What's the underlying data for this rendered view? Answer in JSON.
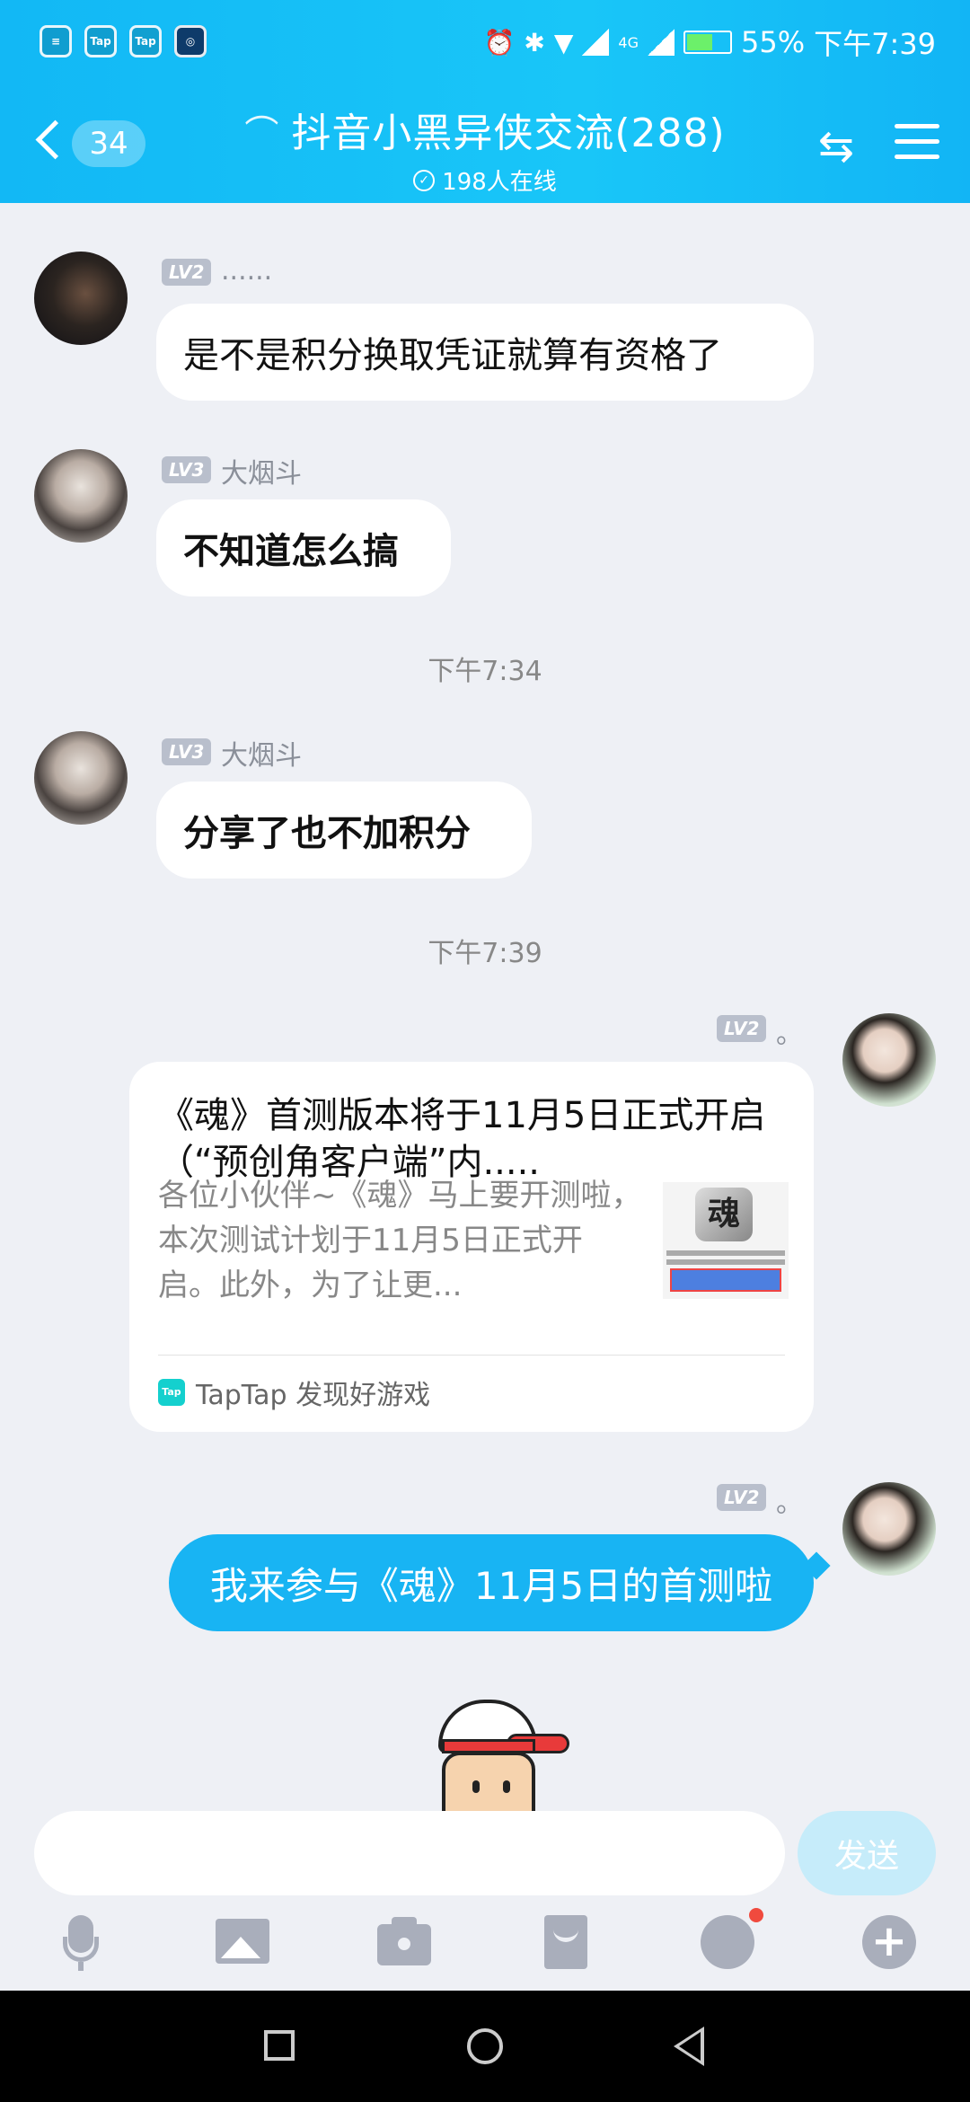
{
  "status_bar": {
    "apps": [
      "Tap",
      "Tap"
    ],
    "network": "4G",
    "battery": "55%",
    "time": "下午7:39",
    "battery_level": 0.55
  },
  "header": {
    "unread_count": "34",
    "title": "抖音小黑异侠交流(288)",
    "online": "198人在线"
  },
  "messages": [
    {
      "level": "LV2",
      "nickname": "......",
      "text": "是不是积分换取凭证就算有资格了"
    },
    {
      "level": "LV3",
      "nickname": "大烟斗",
      "text": "不知道怎么搞"
    },
    {
      "level": "LV3",
      "nickname": "大烟斗",
      "text": "分享了也不加积分"
    }
  ],
  "time_separators": [
    "下午7:34",
    "下午7:39"
  ],
  "card": {
    "level": "LV2",
    "nickname": "。",
    "title": "《魂》首测版本将于11月5日正式开启（“预创角客户端”内.....",
    "description": "各位小伙伴~《魂》马上要开测啦，本次测试计划于11月5日正式开启。此外，为了让更...",
    "thumb_logo": "魂",
    "source": "TapTap 发现好游戏",
    "source_icon": "Tap"
  },
  "own_message": {
    "level": "LV2",
    "nickname": "。",
    "text": "我来参与《魂》11月5日的首测啦"
  },
  "input": {
    "placeholder": "",
    "send_label": "发送"
  },
  "colors": {
    "header": "#18bef6",
    "own_bubble": "#18b4f3",
    "send_disabled": "#c6ecfa",
    "badge_red": "#f04a3e"
  }
}
